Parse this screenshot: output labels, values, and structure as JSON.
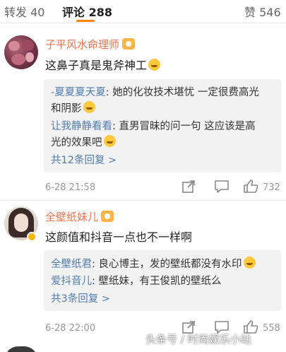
{
  "tabs": {
    "reposts": "转发 40",
    "comments": "评论 288",
    "likes": "赞 546"
  },
  "comments": [
    {
      "username": "子平风水命理师",
      "text": "这鼻子真是鬼斧神工",
      "replies": [
        {
          "user": "-夏夏夏天夏",
          "text": ": 她的化妆技术堪忧 一定很费高光",
          "cont": "和阴影"
        },
        {
          "user": "让我静静看看",
          "text": ": 直男冒昧的问一句  这应该是高",
          "cont": "光的效果吧"
        }
      ],
      "more_replies": "共12条回复 >",
      "timestamp": "6-28 21:58",
      "like_count": "732"
    },
    {
      "username": "全壁纸妹儿",
      "text": "这颜值和抖音一点也不一样啊",
      "replies": [
        {
          "user": "全壁纸君",
          "text": ": 良心博主，发的壁纸都没有水印"
        },
        {
          "user": "爱抖音儿",
          "text": ": 壁纸妹，有王俊凯的壁纸么"
        }
      ],
      "more_replies": "共3条回复 >",
      "timestamp": "6-28 22:00",
      "like_count": "558"
    }
  ],
  "watermark": "头条号 / 时尚娱乐小站",
  "colors": {
    "accent": "#ff8200",
    "username": "#eb7350",
    "link": "#507daf",
    "reply_bg": "#f2f2f2"
  }
}
